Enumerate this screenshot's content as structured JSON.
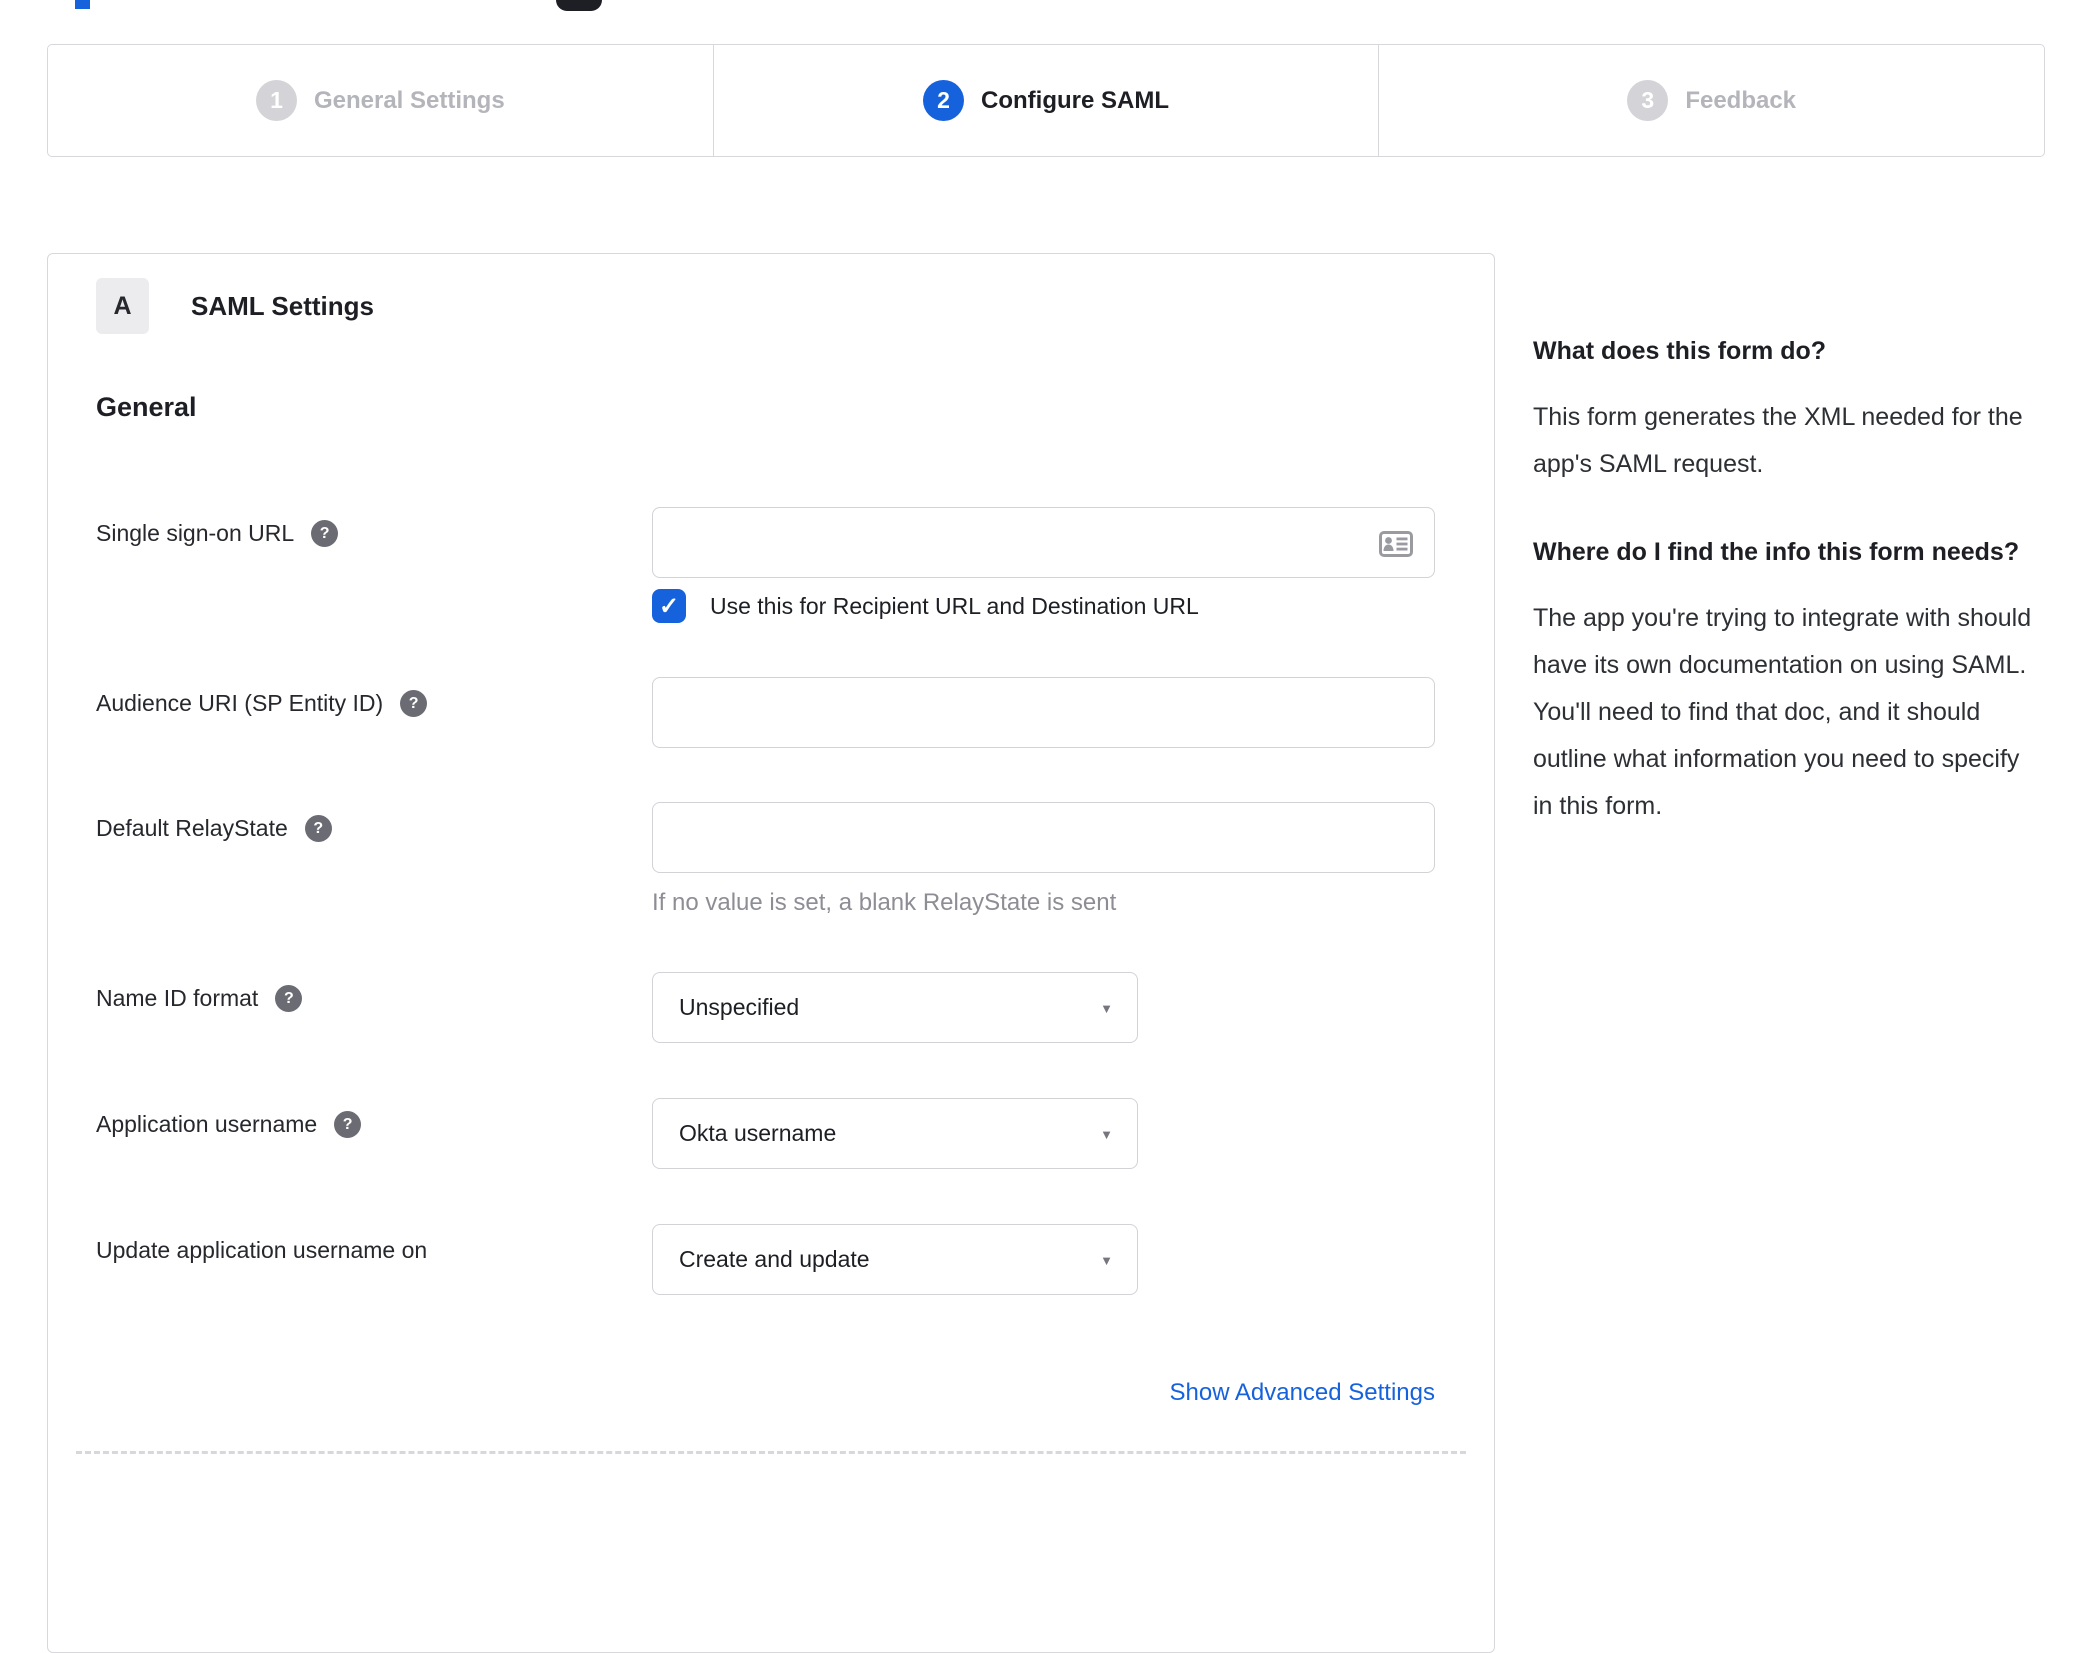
{
  "stepper": {
    "steps": [
      {
        "number": "1",
        "label": "General Settings",
        "state": "inactive"
      },
      {
        "number": "2",
        "label": "Configure SAML",
        "state": "active"
      },
      {
        "number": "3",
        "label": "Feedback",
        "state": "inactive"
      }
    ]
  },
  "panel": {
    "section_badge": "A",
    "section_title": "SAML Settings",
    "subsection_title": "General"
  },
  "form": {
    "sso_url": {
      "label": "Single sign-on URL",
      "value": "",
      "checkbox_checked": "true",
      "checkbox_label": "Use this for Recipient URL and Destination URL"
    },
    "audience_uri": {
      "label": "Audience URI (SP Entity ID)",
      "value": ""
    },
    "relay_state": {
      "label": "Default RelayState",
      "value": "",
      "hint": "If no value is set, a blank RelayState is sent"
    },
    "name_id_format": {
      "label": "Name ID format",
      "value": "Unspecified"
    },
    "app_username": {
      "label": "Application username",
      "value": "Okta username"
    },
    "update_app_username": {
      "label": "Update application username on",
      "value": "Create and update"
    },
    "advanced_link": "Show Advanced Settings"
  },
  "sidebar": {
    "help1_title": "What does this form do?",
    "help1_body": "This form generates the XML needed for the app's SAML request.",
    "help2_title": "Where do I find the info this form needs?",
    "help2_body": "The app you're trying to integrate with should have its own documentation on using SAML. You'll need to find that doc, and it should outline what information you need to specify in this form."
  },
  "icons": {
    "help": "?",
    "check": "✓",
    "caret": "▼"
  },
  "colors": {
    "accent_blue": "#1662dd",
    "inactive_gray": "#d3d3d8",
    "border_gray": "#d8d8dc",
    "hint_gray": "#8d8d95"
  }
}
